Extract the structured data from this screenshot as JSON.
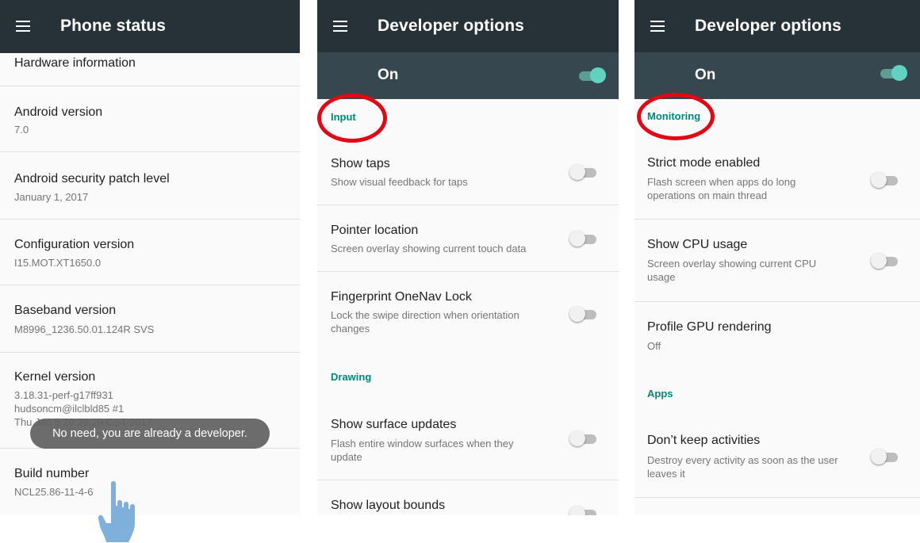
{
  "panel1": {
    "title": "Phone status",
    "items": [
      {
        "title": "Hardware information",
        "subtitle": ""
      },
      {
        "title": "Android version",
        "subtitle": "7.0"
      },
      {
        "title": "Android security patch level",
        "subtitle": "January 1, 2017"
      },
      {
        "title": "Configuration version",
        "subtitle": "I15.MOT.XT1650.0"
      },
      {
        "title": "Baseband version",
        "subtitle": "M8996_1236.50.01.124R SVS"
      },
      {
        "title": "Kernel version",
        "subtitle_lines": [
          "3.18.31-perf-g17ff931",
          "hudsoncm@ilclbld85 #1",
          "Thu Jan 5 20:28:29 CST 2017"
        ]
      },
      {
        "title": "Build number",
        "subtitle": "NCL25.86-11-4-6"
      }
    ],
    "toast": "No need, you are already a developer."
  },
  "panel2": {
    "title": "Developer options",
    "master_switch": {
      "label": "On",
      "checked": true
    },
    "section_input": "Input",
    "items": [
      {
        "title": "Show taps",
        "subtitle": "Show visual feedback for taps",
        "checked": false
      },
      {
        "title": "Pointer location",
        "subtitle": "Screen overlay showing current touch data",
        "checked": false
      },
      {
        "title": "Fingerprint OneNav Lock",
        "subtitle_lines": [
          "Lock the swipe direction when orientation",
          "changes"
        ],
        "checked": false
      }
    ],
    "section_drawing": "Drawing",
    "items2": [
      {
        "title": "Show surface updates",
        "subtitle_lines": [
          "Flash entire window surfaces when they",
          "update"
        ],
        "checked": false
      },
      {
        "title": "Show layout bounds",
        "checked": false
      }
    ]
  },
  "panel3": {
    "title": "Developer options",
    "master_switch": {
      "label": "On",
      "checked": true
    },
    "section_monitoring": "Monitoring",
    "items": [
      {
        "title": "Strict mode enabled",
        "subtitle_lines": [
          "Flash screen when apps do long",
          "operations on main thread"
        ],
        "checked": false
      },
      {
        "title": "Show CPU usage",
        "subtitle_lines": [
          "Screen overlay showing current CPU",
          "usage"
        ],
        "checked": false
      },
      {
        "title": "Profile GPU rendering",
        "subtitle": "Off"
      }
    ],
    "section_apps": "Apps",
    "items2": [
      {
        "title": "Don’t keep activities",
        "subtitle_lines": [
          "Destroy every activity as soon as the user",
          "leaves it"
        ],
        "checked": false
      }
    ]
  },
  "colors": {
    "toolbar": "#263238",
    "switch_bar": "#37474f",
    "accent": "#00897b",
    "highlight_circle": "#e30613"
  }
}
